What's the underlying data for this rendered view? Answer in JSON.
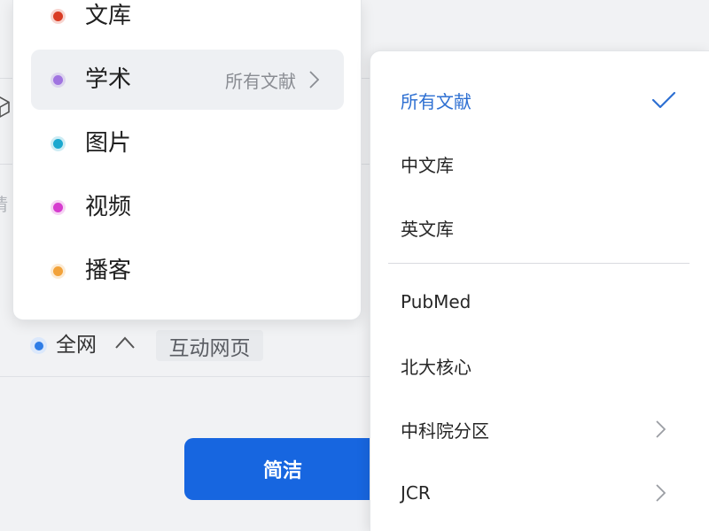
{
  "background": {
    "search_placeholder_fragment": "请",
    "scope": {
      "selected_label": "全网",
      "tag_label": "互动网页"
    },
    "mode_button_label": "简洁",
    "icons": {
      "left_edge": "cube-icon",
      "scope_toggle": "chevron-up-icon"
    }
  },
  "source_menu": {
    "items": [
      {
        "label": "文库",
        "color": "#d93c24"
      },
      {
        "label": "学术",
        "color": "#a074e0",
        "highlighted": true,
        "current_sub_label": "所有文献",
        "icon": "chevron-right-icon"
      },
      {
        "label": "图片",
        "color": "#1ba8cf"
      },
      {
        "label": "视频",
        "color": "#d63ccf"
      },
      {
        "label": "播客",
        "color": "#f2a23a"
      }
    ]
  },
  "academic_submenu": {
    "primary_items": [
      {
        "label": "所有文献",
        "selected": true,
        "icon": "check-icon"
      },
      {
        "label": "中文库"
      },
      {
        "label": "英文库"
      }
    ],
    "secondary_items": [
      {
        "label": "PubMed"
      },
      {
        "label": "北大核心"
      },
      {
        "label": "中科院分区",
        "has_submenu": true,
        "icon": "chevron-right-icon"
      },
      {
        "label": "JCR",
        "has_submenu": true,
        "icon": "chevron-right-icon"
      }
    ]
  },
  "colors": {
    "accent": "#2d6fd2",
    "primary_button": "#1766e0",
    "radio": "#2f7de6",
    "text": "#1f1f1f",
    "muted_text": "#8a8d93",
    "chevron": "#9a9da3"
  }
}
